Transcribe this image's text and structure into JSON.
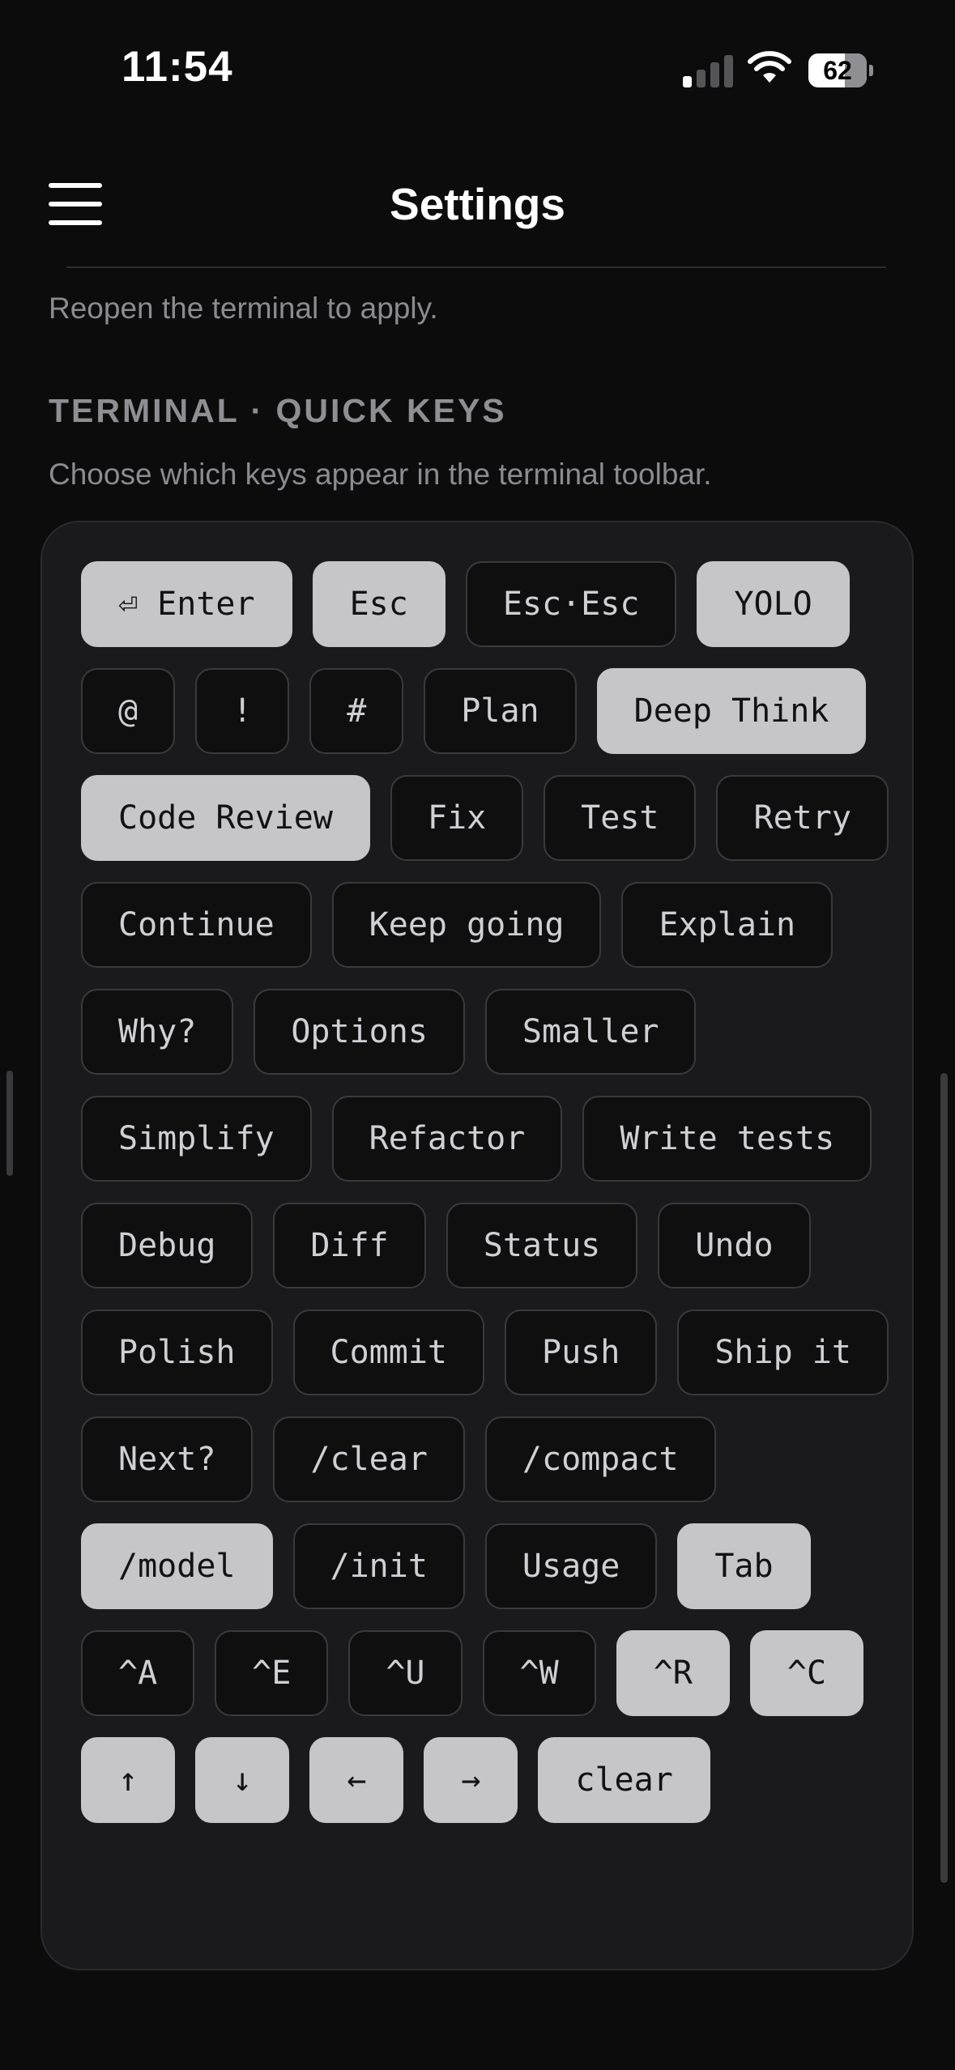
{
  "status_bar": {
    "time": "11:54",
    "battery_percent": "62",
    "battery_level": 0.62,
    "signal_bars_active": 1,
    "signal_bars_total": 4
  },
  "header": {
    "title": "Settings",
    "menu_icon": "hamburger-menu-icon"
  },
  "reopen_note": "Reopen the terminal to apply.",
  "quick_keys": {
    "section_title": "TERMINAL · QUICK KEYS",
    "description": "Choose which keys appear in the terminal toolbar.",
    "selected_color": "#c6c6c8",
    "unselected_color": "#0f0f10",
    "keys": [
      {
        "label": "⏎ Enter",
        "selected": true
      },
      {
        "label": "Esc",
        "selected": true
      },
      {
        "label": "Esc·Esc",
        "selected": false
      },
      {
        "label": "YOLO",
        "selected": true
      },
      {
        "label": "@",
        "selected": false
      },
      {
        "label": "!",
        "selected": false
      },
      {
        "label": "#",
        "selected": false
      },
      {
        "label": "Plan",
        "selected": false
      },
      {
        "label": "Deep Think",
        "selected": true
      },
      {
        "label": "Code Review",
        "selected": true
      },
      {
        "label": "Fix",
        "selected": false
      },
      {
        "label": "Test",
        "selected": false
      },
      {
        "label": "Retry",
        "selected": false
      },
      {
        "label": "Continue",
        "selected": false
      },
      {
        "label": "Keep going",
        "selected": false
      },
      {
        "label": "Explain",
        "selected": false
      },
      {
        "label": "Why?",
        "selected": false
      },
      {
        "label": "Options",
        "selected": false
      },
      {
        "label": "Smaller",
        "selected": false
      },
      {
        "label": "Simplify",
        "selected": false
      },
      {
        "label": "Refactor",
        "selected": false
      },
      {
        "label": "Write tests",
        "selected": false
      },
      {
        "label": "Debug",
        "selected": false
      },
      {
        "label": "Diff",
        "selected": false
      },
      {
        "label": "Status",
        "selected": false
      },
      {
        "label": "Undo",
        "selected": false
      },
      {
        "label": "Polish",
        "selected": false
      },
      {
        "label": "Commit",
        "selected": false
      },
      {
        "label": "Push",
        "selected": false
      },
      {
        "label": "Ship it",
        "selected": false
      },
      {
        "label": "Next?",
        "selected": false
      },
      {
        "label": "/clear",
        "selected": false
      },
      {
        "label": "/compact",
        "selected": false
      },
      {
        "label": "/model",
        "selected": true
      },
      {
        "label": "/init",
        "selected": false
      },
      {
        "label": "Usage",
        "selected": false
      },
      {
        "label": "Tab",
        "selected": true
      },
      {
        "label": "^A",
        "selected": false
      },
      {
        "label": "^E",
        "selected": false
      },
      {
        "label": "^U",
        "selected": false
      },
      {
        "label": "^W",
        "selected": false
      },
      {
        "label": "^R",
        "selected": true
      },
      {
        "label": "^C",
        "selected": true
      },
      {
        "label": "↑",
        "selected": true
      },
      {
        "label": "↓",
        "selected": true
      },
      {
        "label": "←",
        "selected": true
      },
      {
        "label": "→",
        "selected": true
      },
      {
        "label": "clear",
        "selected": true
      }
    ]
  }
}
